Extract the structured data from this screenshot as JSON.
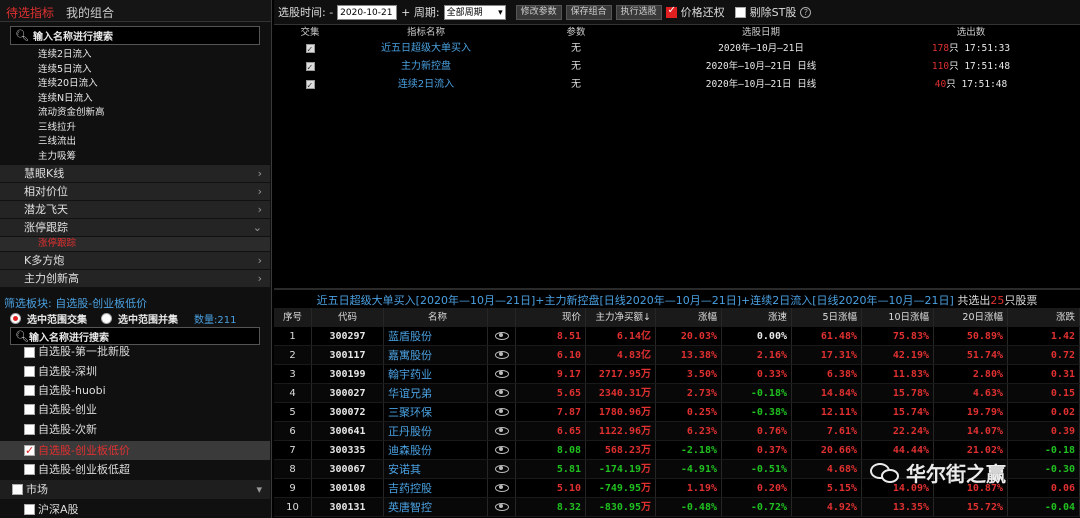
{
  "left": {
    "tabs": [
      "待选指标",
      "我的组合"
    ],
    "search_placeholder": "输入名称进行搜索",
    "leaf_items": [
      "连续2日流入",
      "连续5日流入",
      "连续20日流入",
      "连续N日流入",
      "流动资金创新高",
      "三线拉升",
      "三线流出",
      "主力吸筹"
    ],
    "groups": [
      "慧眼K线",
      "相对价位",
      "潜龙飞天",
      "涨停跟踪",
      "K多方炮",
      "主力创新高"
    ],
    "group_chevrons": [
      "›",
      "›",
      "›",
      "⌄",
      "›",
      "›"
    ],
    "selected_sub": "涨停跟踪",
    "filter_title": "筛选板块: 自选股-创业板低价",
    "radio1": "选中范围交集",
    "radio2": "选中范围并集",
    "count": "数量:211",
    "search2_placeholder": "输入名称进行搜索",
    "list_items": [
      "自选股-第一批新股",
      "自选股-深圳",
      "自选股-huobi",
      "自选股-创业",
      "自选股-次新",
      "自选股-创业板低价",
      "自选股-创业板低超"
    ],
    "market": "市场",
    "market_sub": "沪深A股"
  },
  "toolbar": {
    "date_label": "选股时间: -",
    "date_value": "2020-10-21",
    "period_label": "+ 周期:",
    "period_value": "全部周期",
    "btn_modify": "修改参数",
    "btn_save": "保存组合",
    "btn_exec": "执行选股",
    "price_restore": "价格还权",
    "exclude_st": "剔除ST股",
    "help": "?"
  },
  "top_table": {
    "headers": [
      "交集",
      "指标名称",
      "参数",
      "选股日期",
      "选出数"
    ],
    "rows": [
      {
        "name": "近五日超级大单买入",
        "param": "无",
        "date": "2020年—10月—21日",
        "count": "178",
        "unit": "只",
        "time": "17:51:33"
      },
      {
        "name": "主力新控盘",
        "param": "无",
        "date": "2020年—10月—21日 日线",
        "count": "110",
        "unit": "只",
        "time": "17:51:48"
      },
      {
        "name": "连续2日流入",
        "param": "无",
        "date": "2020年—10月—21日 日线",
        "count": "40",
        "unit": "只",
        "time": "17:51:48"
      }
    ]
  },
  "result": {
    "title": "近五日超级大单买入[2020年—10月—21日]+主力新控盘[日线2020年—10月—21日]+连续2日流入[日线2020年—10月—21日]",
    "mid": " 共选出",
    "count": "25",
    "tail": "只股票"
  },
  "bottom_table": {
    "headers": [
      "序号",
      "代码",
      "名称",
      "",
      "现价",
      "主力净买额↓",
      "涨幅",
      "涨速",
      "5日涨幅",
      "10日涨幅",
      "20日涨幅",
      "涨跌"
    ],
    "rows": [
      {
        "no": "1",
        "code": "300297",
        "name": "蓝盾股份",
        "price": "8.51",
        "net": "6.14",
        "unit": "亿",
        "pct": "20.03%",
        "speed": "0.00%",
        "d5": "61.48%",
        "d10": "75.83%",
        "d20": "50.89%",
        "chg": "1.42",
        "dirs": [
          "up",
          "up",
          "up",
          "wh",
          "up",
          "up",
          "up",
          "up"
        ]
      },
      {
        "no": "2",
        "code": "300117",
        "name": "嘉寓股份",
        "price": "6.10",
        "net": "4.83",
        "unit": "亿",
        "pct": "13.38%",
        "speed": "2.16%",
        "d5": "17.31%",
        "d10": "42.19%",
        "d20": "51.74%",
        "chg": "0.72",
        "dirs": [
          "up",
          "up",
          "up",
          "up",
          "up",
          "up",
          "up",
          "up"
        ]
      },
      {
        "no": "3",
        "code": "300199",
        "name": "翰宇药业",
        "price": "9.17",
        "net": "2717.95",
        "unit": "万",
        "pct": "3.50%",
        "speed": "0.33%",
        "d5": "6.38%",
        "d10": "11.83%",
        "d20": "2.80%",
        "chg": "0.31",
        "dirs": [
          "up",
          "up",
          "up",
          "up",
          "up",
          "up",
          "up",
          "up"
        ]
      },
      {
        "no": "4",
        "code": "300027",
        "name": "华谊兄弟",
        "price": "5.65",
        "net": "2340.31",
        "unit": "万",
        "pct": "2.73%",
        "speed": "-0.18%",
        "d5": "14.84%",
        "d10": "15.78%",
        "d20": "4.63%",
        "chg": "0.15",
        "dirs": [
          "up",
          "up",
          "up",
          "dn",
          "up",
          "up",
          "up",
          "up"
        ]
      },
      {
        "no": "5",
        "code": "300072",
        "name": "三聚环保",
        "price": "7.87",
        "net": "1780.96",
        "unit": "万",
        "pct": "0.25%",
        "speed": "-0.38%",
        "d5": "12.11%",
        "d10": "15.74%",
        "d20": "19.79%",
        "chg": "0.02",
        "dirs": [
          "up",
          "up",
          "up",
          "dn",
          "up",
          "up",
          "up",
          "up"
        ]
      },
      {
        "no": "6",
        "code": "300641",
        "name": "正丹股份",
        "price": "6.65",
        "net": "1122.96",
        "unit": "万",
        "pct": "6.23%",
        "speed": "0.76%",
        "d5": "7.61%",
        "d10": "22.24%",
        "d20": "14.07%",
        "chg": "0.39",
        "dirs": [
          "up",
          "up",
          "up",
          "up",
          "up",
          "up",
          "up",
          "up"
        ]
      },
      {
        "no": "7",
        "code": "300335",
        "name": "迪森股份",
        "price": "8.08",
        "net": "568.23",
        "unit": "万",
        "pct": "-2.18%",
        "speed": "0.37%",
        "d5": "20.66%",
        "d10": "44.44%",
        "d20": "21.02%",
        "chg": "-0.18",
        "dirs": [
          "dn",
          "up",
          "dn",
          "up",
          "up",
          "up",
          "up",
          "dn"
        ]
      },
      {
        "no": "8",
        "code": "300067",
        "name": "安诺其",
        "price": "5.81",
        "net": "-174.19",
        "unit": "万",
        "pct": "-4.91%",
        "speed": "-0.51%",
        "d5": "4.68%",
        "d10": "",
        "d20": "",
        "chg": "-0.30",
        "dirs": [
          "dn",
          "dn",
          "dn",
          "dn",
          "up",
          "up",
          "up",
          "dn"
        ]
      },
      {
        "no": "9",
        "code": "300108",
        "name": "吉药控股",
        "price": "5.10",
        "net": "-749.95",
        "unit": "万",
        "pct": "1.19%",
        "speed": "0.20%",
        "d5": "5.15%",
        "d10": "14.09%",
        "d20": "10.87%",
        "chg": "0.06",
        "dirs": [
          "up",
          "dn",
          "up",
          "up",
          "up",
          "up",
          "up",
          "up"
        ]
      },
      {
        "no": "10",
        "code": "300131",
        "name": "英唐智控",
        "price": "8.32",
        "net": "-830.95",
        "unit": "万",
        "pct": "-0.48%",
        "speed": "-0.72%",
        "d5": "4.92%",
        "d10": "13.35%",
        "d20": "15.72%",
        "chg": "-0.04",
        "dirs": [
          "dn",
          "dn",
          "dn",
          "dn",
          "up",
          "up",
          "up",
          "dn"
        ]
      }
    ]
  },
  "watermark": "华尔街之赢"
}
